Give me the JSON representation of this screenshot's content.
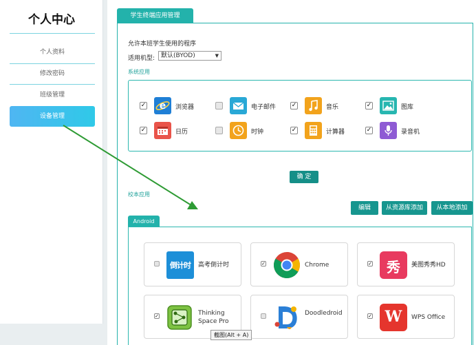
{
  "sidebar": {
    "title": "个人中心",
    "items": [
      {
        "label": "个人资料"
      },
      {
        "label": "修改密码"
      },
      {
        "label": "班级管理"
      },
      {
        "label": "设备管理"
      }
    ]
  },
  "main": {
    "tab_label": "学生终端应用管理",
    "allow_text": "允许本班学生使用的程序",
    "model_label": "适用机型:",
    "model_select_value": "默认(BYOD)",
    "system_section_label": "系统应用",
    "system_apps": [
      {
        "name": "浏览器",
        "checked": true,
        "checkmark": "✓",
        "icon": "ie-browser-icon",
        "glyph": "e",
        "color": "#1f7fd6"
      },
      {
        "name": "电子邮件",
        "checked": false,
        "checkmark": "",
        "icon": "email-icon",
        "glyph": "✉",
        "color": "#29a8d6"
      },
      {
        "name": "音乐",
        "checked": true,
        "checkmark": "✓",
        "icon": "music-icon",
        "glyph": "♫",
        "color": "#f2a31c"
      },
      {
        "name": "图库",
        "checked": true,
        "checkmark": "✓",
        "icon": "gallery-icon",
        "glyph": "▣",
        "color": "#27b6b0"
      },
      {
        "name": "日历",
        "checked": true,
        "checkmark": "✓",
        "icon": "calendar-icon",
        "glyph": "▦",
        "color": "#e9544a"
      },
      {
        "name": "时钟",
        "checked": false,
        "checkmark": "",
        "icon": "clock-icon",
        "glyph": "◷",
        "color": "#f2a31c"
      },
      {
        "name": "计算器",
        "checked": true,
        "checkmark": "✓",
        "icon": "calculator-icon",
        "glyph": "▤",
        "color": "#f2a31c"
      },
      {
        "name": "录音机",
        "checked": true,
        "checkmark": "✓",
        "icon": "microphone-icon",
        "glyph": "♪",
        "color": "#8e5bd4"
      }
    ],
    "confirm_label": "确 定",
    "school_section_label": "校本应用",
    "toolbar": {
      "edit_label": "编辑",
      "add_from_library_label": "从资源库添加",
      "add_local_label": "从本地添加"
    },
    "android_tab_label": "Android",
    "school_apps": [
      {
        "name": "高考倒计时",
        "checked": false,
        "checkmark": "",
        "logo": "countdown-logo",
        "logo_text": "倒计时"
      },
      {
        "name": "Chrome",
        "checked": true,
        "checkmark": "✓",
        "logo": "chrome-logo"
      },
      {
        "name": "美图秀秀HD",
        "checked": true,
        "checkmark": "✓",
        "logo": "meitu-logo",
        "logo_text": "秀"
      },
      {
        "name": "Thinking Space Pro",
        "checked": true,
        "checkmark": "✓",
        "logo": "thinking-space-logo"
      },
      {
        "name": "Doodledroid",
        "checked": false,
        "checkmark": "",
        "logo": "doodledroid-logo"
      },
      {
        "name": "WPS Office",
        "checked": true,
        "checkmark": "✓",
        "logo": "wps-logo",
        "logo_text": "W"
      }
    ]
  },
  "tooltip": "截图(Alt + A)",
  "colors": {
    "accent": "#23b2ab",
    "button": "#17968f",
    "sidebar_active": "#3ec0ee",
    "arrow": "#2e9b34"
  }
}
